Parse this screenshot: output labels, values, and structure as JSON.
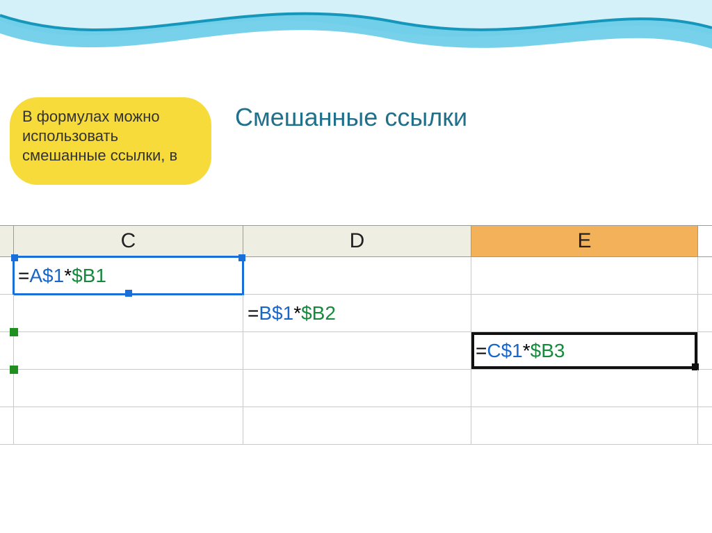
{
  "title": "Смешанные ссылки",
  "callout": {
    "text": "   В формулах можно использовать смешанные ссылки, в"
  },
  "columns": {
    "c": "C",
    "d": "D",
    "e": "E"
  },
  "cells": {
    "c1": {
      "eq": "=",
      "ref1": "A$1",
      "op": "*",
      "ref2": "$B1"
    },
    "d2": {
      "eq": "=",
      "ref1": "B$1",
      "op": "*",
      "ref2": "$B2"
    },
    "e3": {
      "eq": "=",
      "ref1": "C$1",
      "op": "*",
      "ref2": "$B3"
    }
  }
}
